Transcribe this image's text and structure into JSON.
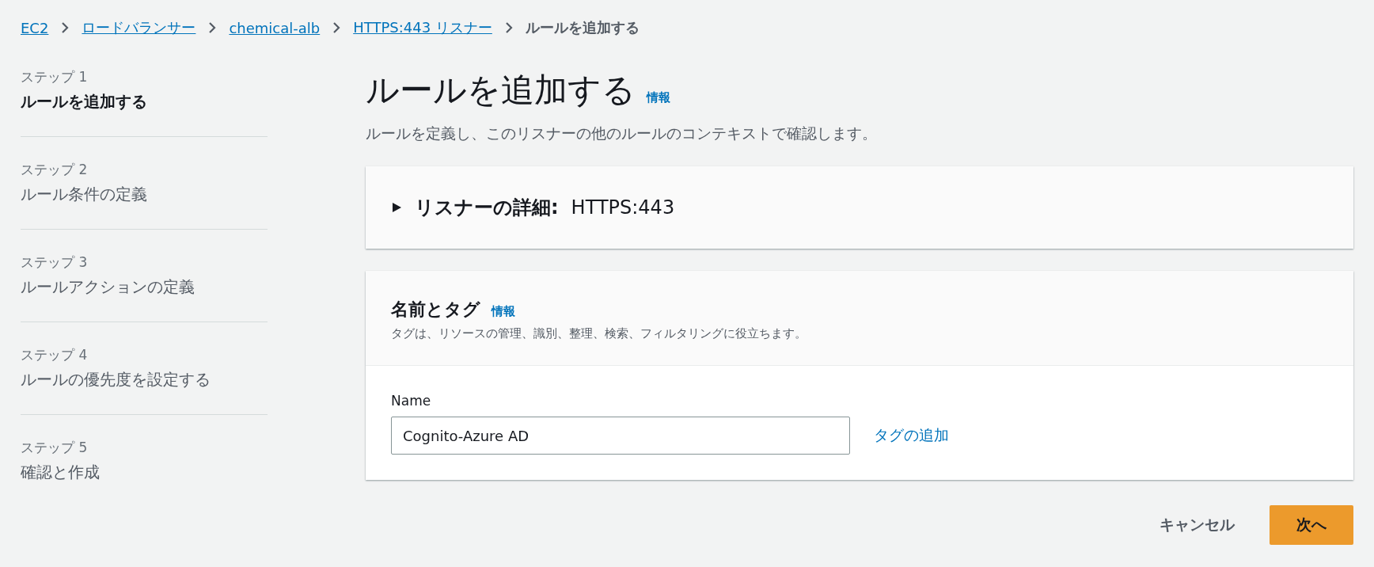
{
  "breadcrumb": [
    {
      "label": "EC2",
      "link": true
    },
    {
      "label": "ロードバランサー",
      "link": true
    },
    {
      "label": "chemical-alb",
      "link": true
    },
    {
      "label": "HTTPS:443 リスナー",
      "link": true
    },
    {
      "label": "ルールを追加する",
      "link": false
    }
  ],
  "steps": [
    {
      "step": "ステップ 1",
      "title": "ルールを追加する",
      "selected": true
    },
    {
      "step": "ステップ 2",
      "title": "ルール条件の定義",
      "selected": false
    },
    {
      "step": "ステップ 3",
      "title": "ルールアクションの定義",
      "selected": false
    },
    {
      "step": "ステップ 4",
      "title": "ルールの優先度を設定する",
      "selected": false
    },
    {
      "step": "ステップ 5",
      "title": "確認と作成",
      "selected": false
    }
  ],
  "page": {
    "title": "ルールを追加する",
    "info": "情報",
    "description": "ルールを定義し、このリスナーの他のルールのコンテキストで確認します。"
  },
  "listener_panel": {
    "label": "リスナーの詳細:",
    "value": "HTTPS:443",
    "expanded": false
  },
  "tags_panel": {
    "title": "名前とタグ",
    "info": "情報",
    "description": "タグは、リソースの管理、識別、整理、検索、フィルタリングに役立ちます。",
    "field_label": "Name",
    "field_value": "Cognito-Azure AD",
    "add_tag": "タグの追加"
  },
  "buttons": {
    "cancel": "キャンセル",
    "next": "次へ"
  }
}
